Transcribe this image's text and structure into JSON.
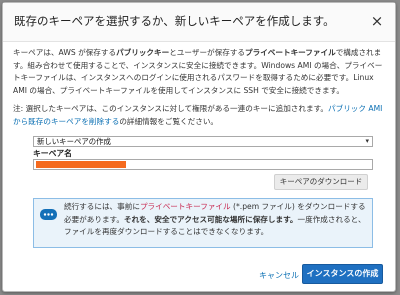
{
  "dialog": {
    "title": "既存のキーペアを選択するか、新しいキーペアを作成します。",
    "close_symbol": "×"
  },
  "description": {
    "t1": "キーペアは、AWS が保存する",
    "t1_bold": "パブリックキー",
    "t2": "とユーザーが保存する",
    "t2_bold": "プライベートキーファイル",
    "t3": "で構成されます。組み合わせて使用することで、インスタンスに安全に接続できます。Windows AMI の場合、プライベートキーファイルは、インスタンスへのログインに使用されるパスワードを取得するために必要です。Linux AMI の場合、プライベートキーファイルを使用してインスタンスに SSH で安全に接続できます。"
  },
  "note": {
    "t1": "注: 選択したキーペアは、このインスタンスに対して権限がある一連のキーに追加されます。",
    "link": "パブリック AMI から既存のキーペアを削除する",
    "t2": "の詳細情報をご覧ください。"
  },
  "keypair_select": {
    "value": "新しいキーペアの作成",
    "arrow": "▾"
  },
  "keypair_name": {
    "label": "キーペア名"
  },
  "download_button": {
    "label": "キーペアのダウンロード"
  },
  "info_box": {
    "t1": "続行するには、事前に",
    "highlight": "プライベートキーファイル",
    "t2": " (*.pem ファイル) をダウンロードする必要があります。",
    "bold": "それを、安全でアクセス可能な場所に保存します。",
    "t3": "一度作成されると、ファイルを再度ダウンロードすることはできなくなります。",
    "icon": "chat-bubble-icon"
  },
  "footer": {
    "cancel_label": "キャンセル",
    "launch_label": "インスタンスの作成"
  },
  "colors": {
    "accent": "#1f70c1",
    "link": "#0a6fb3",
    "redaction": "#f56a1e",
    "info_bg": "#eaf3fa"
  }
}
